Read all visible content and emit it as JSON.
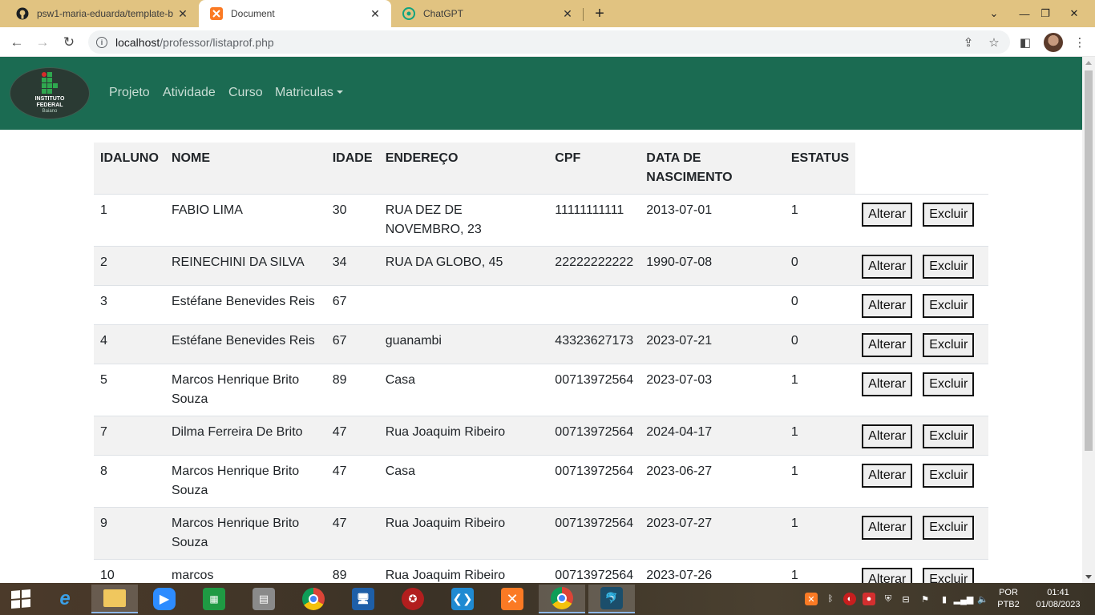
{
  "browser": {
    "tabs": [
      {
        "title": "psw1-maria-eduarda/template-b",
        "icon": "github-icon",
        "active": false
      },
      {
        "title": "Document",
        "icon": "xampp-icon",
        "active": true
      },
      {
        "title": "ChatGPT",
        "icon": "chatgpt-icon",
        "active": false
      }
    ],
    "new_tab": "+",
    "url_host": "localhost",
    "url_path": "/professor/listaprof.php"
  },
  "navbar": {
    "logo": {
      "line1": "INSTITUTO",
      "line2": "FEDERAL",
      "line3": "Baiano"
    },
    "links": [
      "Projeto",
      "Atividade",
      "Curso",
      "Matriculas"
    ],
    "color": "#1b6b52"
  },
  "table": {
    "headers": [
      "IDALUNO",
      "NOME",
      "IDADE",
      "ENDEREÇO",
      "CPF",
      "DATA DE NASCIMENTO",
      "ESTATUS"
    ],
    "rows": [
      {
        "id": "1",
        "nome": "FABIO LIMA",
        "idade": "30",
        "endereco": "RUA DEZ DE NOVEMBRO, 23",
        "cpf": "11111111111",
        "nascimento": "2013-07-01",
        "estatus": "1"
      },
      {
        "id": "2",
        "nome": "REINECHINI DA SILVA",
        "idade": "34",
        "endereco": "RUA DA GLOBO, 45",
        "cpf": "22222222222",
        "nascimento": "1990-07-08",
        "estatus": "0"
      },
      {
        "id": "3",
        "nome": "Estéfane Benevides Reis",
        "idade": "67",
        "endereco": "",
        "cpf": "",
        "nascimento": "",
        "estatus": "0"
      },
      {
        "id": "4",
        "nome": "Estéfane Benevides Reis",
        "idade": "67",
        "endereco": "guanambi",
        "cpf": "43323627173",
        "nascimento": "2023-07-21",
        "estatus": "0"
      },
      {
        "id": "5",
        "nome": "Marcos Henrique Brito Souza",
        "idade": "89",
        "endereco": "Casa",
        "cpf": "00713972564",
        "nascimento": "2023-07-03",
        "estatus": "1"
      },
      {
        "id": "7",
        "nome": "Dilma Ferreira De Brito",
        "idade": "47",
        "endereco": "Rua Joaquim Ribeiro",
        "cpf": "00713972564",
        "nascimento": "2024-04-17",
        "estatus": "1"
      },
      {
        "id": "8",
        "nome": "Marcos Henrique Brito Souza",
        "idade": "47",
        "endereco": "Casa",
        "cpf": "00713972564",
        "nascimento": "2023-06-27",
        "estatus": "1"
      },
      {
        "id": "9",
        "nome": "Marcos Henrique Brito Souza",
        "idade": "47",
        "endereco": "Rua Joaquim Ribeiro",
        "cpf": "00713972564",
        "nascimento": "2023-07-27",
        "estatus": "1"
      },
      {
        "id": "10",
        "nome": "marcos",
        "idade": "89",
        "endereco": "Rua Joaquim Ribeiro",
        "cpf": "00713972564",
        "nascimento": "2023-07-26",
        "estatus": "1"
      }
    ],
    "alterar_label": "Alterar",
    "excluir_label": "Excluir"
  },
  "taskbar": {
    "apps": [
      "internet-explorer-icon",
      "file-explorer-icon",
      "zoom-icon",
      "store-icon",
      "wall-icon",
      "chrome-icon",
      "remote-desktop-icon",
      "shield-icon",
      "vscode-icon",
      "xampp-icon",
      "chrome-profile-icon",
      "mysql-workbench-icon"
    ],
    "lang_top": "POR",
    "lang_bottom": "PTB2",
    "time": "01:41",
    "date": "01/08/2023"
  }
}
